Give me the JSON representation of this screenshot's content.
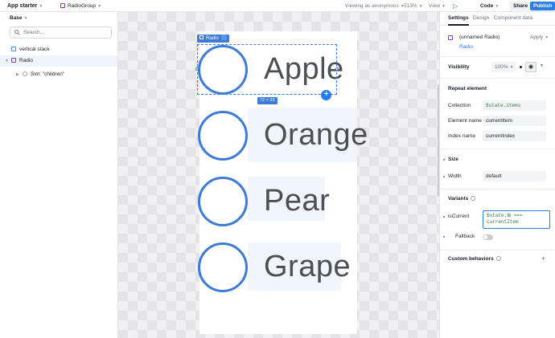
{
  "topbar": {
    "app_title": "App starter",
    "component": "RadioGroup",
    "viewing": "Viewing as anonymous",
    "zoom": "513%",
    "view": "View",
    "code": "Code",
    "share": "Share",
    "publish": "Publish"
  },
  "left_panel": {
    "heading": "Base",
    "search_placeholder": "Search...",
    "tree": [
      {
        "label": "vertical stack"
      },
      {
        "label": "Radio"
      },
      {
        "label": "Slot: \"children\""
      }
    ]
  },
  "canvas": {
    "selection_tag": "Radio",
    "dimension_tag": "72 × 25",
    "items": [
      "Apple",
      "Orange",
      "Pear",
      "Grape"
    ],
    "accent": "#3d7bd8"
  },
  "right_panel": {
    "tabs": [
      "Settings",
      "Design",
      "Component data"
    ],
    "component_name": "(unnamed Radio)",
    "component_link": "Radio",
    "apply": "Apply",
    "visibility": {
      "label": "Visibility",
      "value": "100%"
    },
    "repeat": {
      "heading": "Repeat element",
      "collection_label": "Collection",
      "collection_value": "$state.items",
      "element_name_label": "Element name",
      "element_name_value": "currentItem",
      "index_name_label": "Index name",
      "index_name_value": "currentIndex"
    },
    "size": {
      "heading": "Size",
      "width_label": "Width",
      "width_value": "default"
    },
    "variants": {
      "heading": "Variants",
      "iscurrent_label": "isCurrent",
      "iscurrent_line1": "$state.⊞ ===",
      "iscurrent_line2": "currentItem",
      "fallback_label": "Fallback"
    },
    "custom_behaviors": "Custom behaviors",
    "add": "+"
  }
}
